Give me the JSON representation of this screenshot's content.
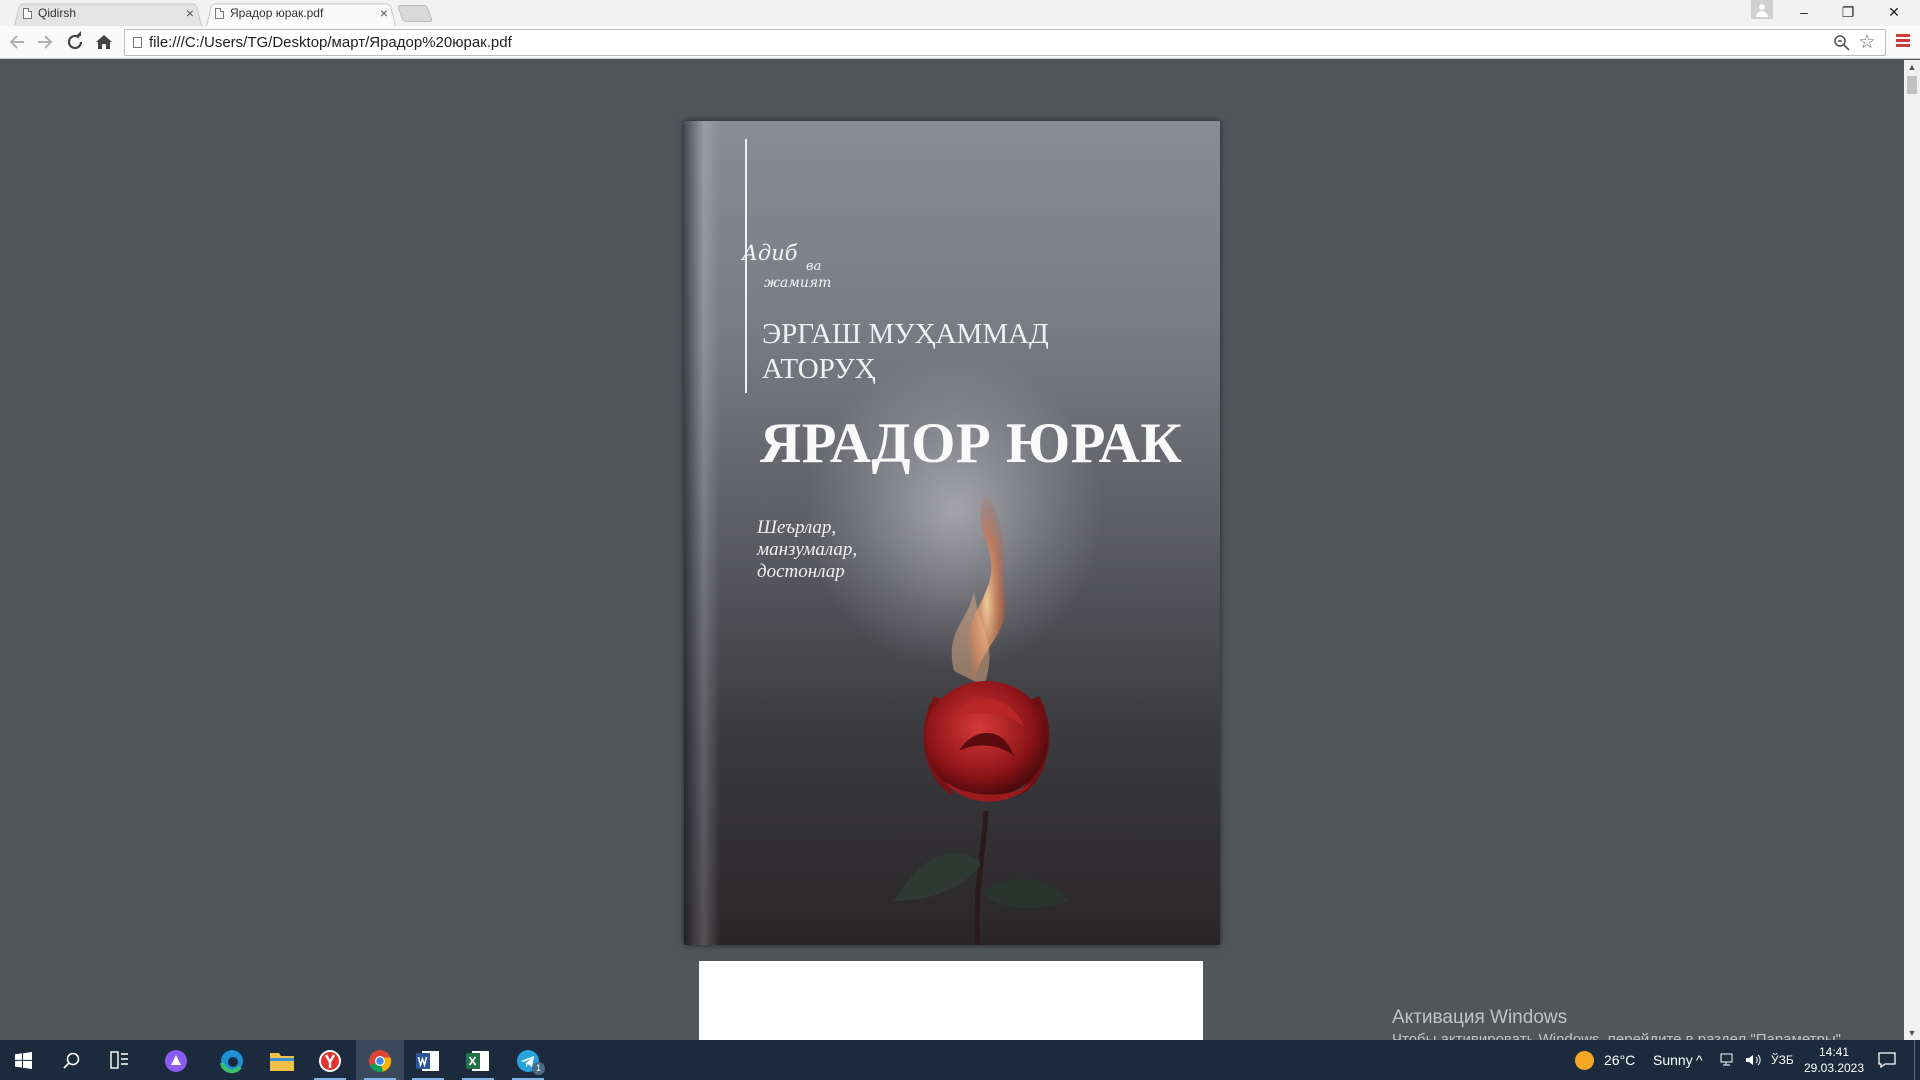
{
  "browser": {
    "tabs": [
      {
        "label": "Qidirsh",
        "active": false
      },
      {
        "label": "Ярадор юрак.pdf",
        "active": true
      }
    ],
    "close_glyph": "×",
    "window_controls": {
      "minimize": "–",
      "restore": "❐",
      "close": "✕"
    },
    "address": "file:///C:/Users/TG/Desktop/март/Ярадор%20юрак.pdf",
    "nav_icons": {
      "back": "back-arrow-icon",
      "forward": "forward-arrow-icon",
      "reload": "reload-icon",
      "home": "home-icon"
    },
    "accent_color": "#d23b3b"
  },
  "document": {
    "series_logo": {
      "line1": "Адиб",
      "line2": "ва",
      "line3": "жамият"
    },
    "author": {
      "line1": "ЭРГАШ МУҲАММАД",
      "line2": "АТОРУҲ"
    },
    "title": "ЯРАДОР ЮРАК",
    "subtitle": {
      "line1": "Шеърлар,",
      "line2": "манзумалар,",
      "line3": "достонлар"
    }
  },
  "activation_notice": {
    "title": "Активация Windows",
    "body": "Чтобы активировать Windows, перейдите в раздел \"Параметры\"."
  },
  "taskbar": {
    "apps": [
      "start-icon",
      "search-icon",
      "task-view-icon",
      "alice-icon",
      "edge-icon",
      "file-explorer-icon",
      "yandex-browser-icon",
      "chrome-icon",
      "word-icon",
      "excel-icon",
      "telegram-icon"
    ],
    "telegram_badge": "1",
    "weather": {
      "temp": "26°C",
      "condition": "Sunny"
    },
    "language": "ЎЗБ",
    "time": "14:41",
    "date": "29.03.2023"
  }
}
